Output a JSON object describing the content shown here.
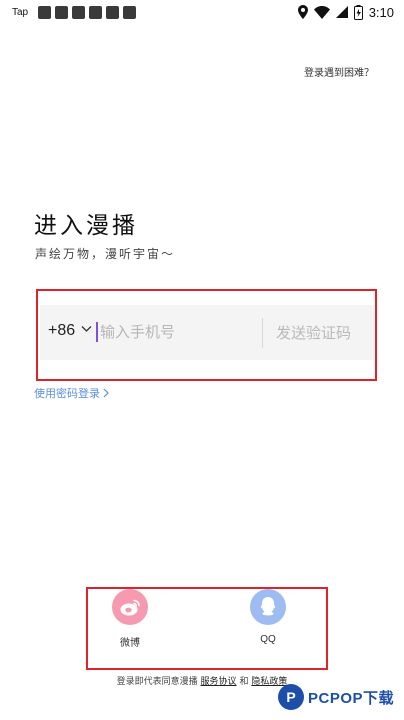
{
  "status_bar": {
    "app_label": "Tap",
    "time": "3:10"
  },
  "header": {
    "help_link": "登录遇到困难？"
  },
  "login": {
    "title": "进入漫播",
    "subtitle": "声绘万物，漫听宇宙～",
    "country_code": "+86",
    "phone_placeholder": "输入手机号",
    "send_code": "发送验证码",
    "password_login": "使用密码登录"
  },
  "social": {
    "items": [
      {
        "label": "微博",
        "icon": "weibo-icon",
        "color": "#f59ab0"
      },
      {
        "label": "QQ",
        "icon": "qq-icon",
        "color": "#9cbcf2"
      }
    ]
  },
  "footer": {
    "agreement_prefix": "登录即代表同意漫播",
    "service_agreement": "服务协议",
    "and_text": "和",
    "privacy_policy": "隐私政策"
  },
  "watermark": {
    "logo_letter": "P",
    "brand_text": "PCPOP下载"
  },
  "colors": {
    "accent": "#5b8fe0",
    "highlight": "#e0232a",
    "cursor": "#7b52d9"
  }
}
